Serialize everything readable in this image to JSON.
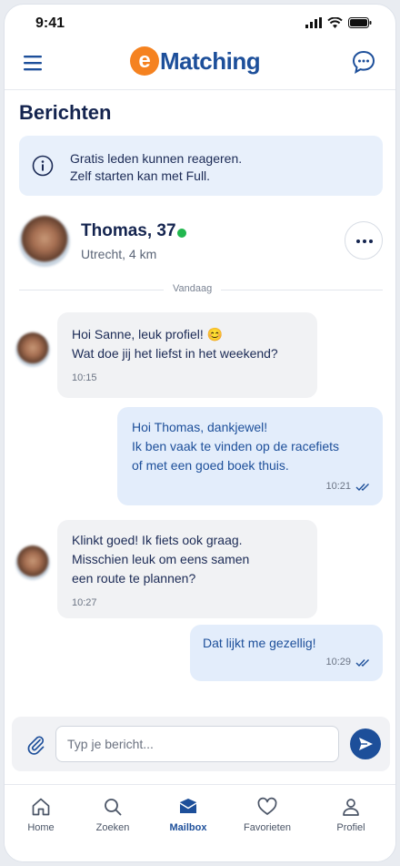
{
  "status_bar": {
    "time": "9:41"
  },
  "header": {
    "logo_letter": "e",
    "logo_text": "Matching",
    "menu_icon": "hamburger-icon",
    "chat_icon": "chat-bubble-icon",
    "brand_color": "#1d4f9a",
    "accent_color": "#f58220"
  },
  "page": {
    "title": "Berichten"
  },
  "notice": {
    "line1": "Gratis leden kunnen reageren.",
    "line2": "Zelf starten kan met Full."
  },
  "contact": {
    "name_age": "Thomas, 37",
    "location": "Utrecht, 4 km",
    "online": true
  },
  "date_separator": "Vandaag",
  "messages": [
    {
      "direction": "in",
      "lines": [
        "Hoi Sanne, leuk profiel! 😊",
        "Wat doe jij het liefst in het weekend?"
      ],
      "time": "10:15"
    },
    {
      "direction": "out",
      "lines": [
        "Hoi Thomas, dankjewel!",
        "Ik ben vaak te vinden op de racefiets",
        "of met een goed boek thuis."
      ],
      "time": "10:21",
      "read": true
    },
    {
      "direction": "in",
      "lines": [
        "Klinkt goed! Ik fiets ook graag.",
        "Misschien leuk om eens samen",
        "een route te plannen?"
      ],
      "time": "10:27"
    },
    {
      "direction": "out",
      "lines": [
        "Dat lijkt me gezellig!"
      ],
      "time": "10:29",
      "read": true
    }
  ],
  "composer": {
    "placeholder": "Typ je bericht...",
    "attach_icon": "paperclip-icon",
    "send_icon": "send-icon"
  },
  "tabs": [
    {
      "label": "Home",
      "icon": "home-icon"
    },
    {
      "label": "Zoeken",
      "icon": "search-icon"
    },
    {
      "label": "Mailbox",
      "icon": "mail-icon",
      "active": true
    },
    {
      "label": "Favorieten",
      "icon": "heart-icon"
    },
    {
      "label": "Profiel",
      "icon": "person-icon"
    }
  ]
}
